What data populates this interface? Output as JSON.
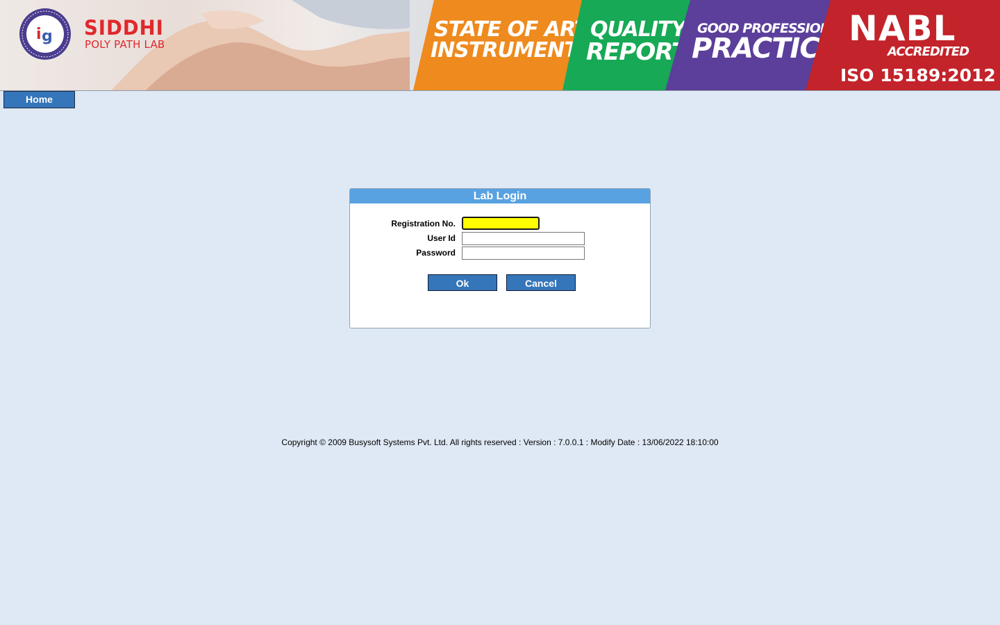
{
  "header": {
    "logo_name": "SIDDHI",
    "logo_sub": "POLY PATH LAB",
    "logo_ring_text": "SIDDHI POLY PATH LAB",
    "banner_panels": {
      "art_line1": "STATE OF ART",
      "art_line2": "INSTRUMENTS",
      "quality_line1": "QUALITY",
      "quality_line2": "REPORT",
      "practice_line1": "GOOD PROFESSIONAL",
      "practice_line2": "PRACTICE",
      "nabl_line1": "NABL",
      "nabl_line2": "ACCREDITED",
      "nabl_line3": "ISO 15189:2012"
    },
    "colors": {
      "orange": "#ee8a1e",
      "green": "#17a955",
      "purple": "#5b3f9a",
      "red": "#c3232a",
      "brand": "#e0282d"
    }
  },
  "nav": {
    "home_label": "Home"
  },
  "login": {
    "title": "Lab Login",
    "registration_label": "Registration No.",
    "registration_value": "",
    "userid_label": "User Id",
    "userid_value": "",
    "password_label": "Password",
    "password_value": "",
    "ok_label": "Ok",
    "cancel_label": "Cancel"
  },
  "footer": {
    "text": "Copyright © 2009 Busysoft Systems Pvt. Ltd. All rights reserved : Version : 7.0.0.1 : Modify Date : 13/06/2022 18:10:00"
  }
}
